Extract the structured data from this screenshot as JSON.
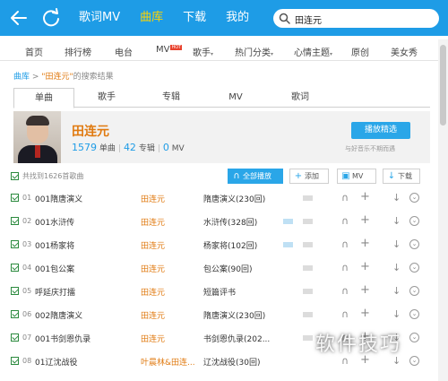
{
  "topbar": {
    "nav": [
      "歌词MV",
      "曲库",
      "下载",
      "我的"
    ],
    "active_index": 1,
    "search_value": "田连元"
  },
  "categories": [
    {
      "label": "首页",
      "arrow": ""
    },
    {
      "label": "排行榜",
      "arrow": ""
    },
    {
      "label": "电台",
      "arrow": ""
    },
    {
      "label": "MV",
      "arrow": "",
      "badge": "HOT"
    },
    {
      "label": "歌手",
      "arrow": "▾"
    },
    {
      "label": "热门分类",
      "arrow": "▾"
    },
    {
      "label": "心情主题",
      "arrow": "▾"
    },
    {
      "label": "原创",
      "arrow": ""
    },
    {
      "label": "美女秀",
      "arrow": ""
    }
  ],
  "breadcrumb": {
    "root": "曲库",
    "separator": ">",
    "keyword": "\"田连元\"",
    "suffix": "的搜索结果"
  },
  "tabs": [
    "单曲",
    "歌手",
    "专辑",
    "MV",
    "歌词"
  ],
  "artist": {
    "name": "田连元",
    "songs_count": "1579",
    "songs_label": "单曲",
    "albums_count": "42",
    "albums_label": "专辑",
    "mv_count": "0",
    "mv_label": "MV",
    "play_button": "播放精选",
    "hint": "与好音乐不期而遇"
  },
  "actions": {
    "total": "共找到1626首歌曲",
    "play_all": "全部播放",
    "add": "添加",
    "mv": "MV",
    "download": "下载"
  },
  "songs": [
    {
      "num": "01",
      "title": "001隋唐演义",
      "artist": "田连元",
      "album": "隋唐演义(230回)",
      "has_mv": false
    },
    {
      "num": "02",
      "title": "001水浒传",
      "artist": "田连元",
      "album": "水浒传(328回)",
      "has_mv": true
    },
    {
      "num": "03",
      "title": "001杨家将",
      "artist": "田连元",
      "album": "杨家将(102回)",
      "has_mv": true
    },
    {
      "num": "04",
      "title": "001包公案",
      "artist": "田连元",
      "album": "包公案(90回)",
      "has_mv": false
    },
    {
      "num": "05",
      "title": "呼延庆打擂",
      "artist": "田连元",
      "album": "短篇评书",
      "has_mv": false
    },
    {
      "num": "06",
      "title": "002隋唐演义",
      "artist": "田连元",
      "album": "隋唐演义(230回)",
      "has_mv": false
    },
    {
      "num": "07",
      "title": "001书剑恩仇录",
      "artist": "田连元",
      "album": "书剑恩仇录(202...",
      "has_mv": false
    },
    {
      "num": "08",
      "title": "01辽沈战役",
      "artist": "叶晨林&田连...",
      "album": "辽沈战役(30回)",
      "has_mv": false
    }
  ],
  "watermark": "软件技巧"
}
